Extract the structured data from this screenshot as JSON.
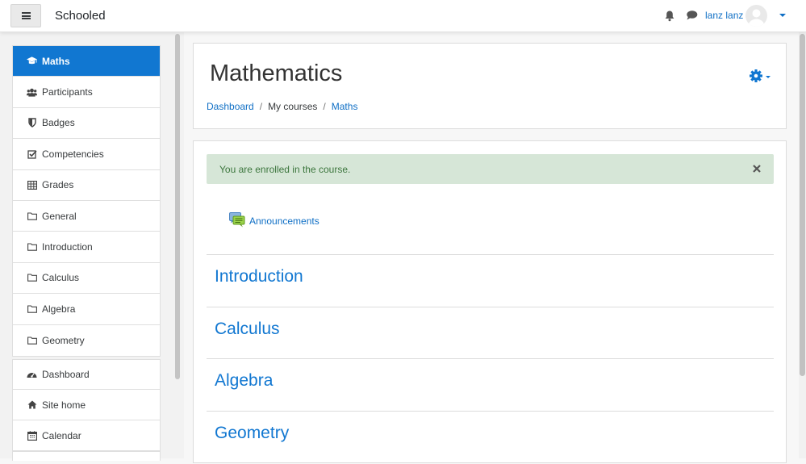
{
  "navbar": {
    "site_name": "Schooled",
    "user_name": "lanz lanz",
    "icons": [
      "menu-icon",
      "bell-icon",
      "chat-icon",
      "avatar-icon",
      "caret-down-icon"
    ]
  },
  "drawer": {
    "course_group": [
      {
        "label": "Maths",
        "icon": "graduation-cap-icon",
        "active": true
      },
      {
        "label": "Participants",
        "icon": "users-icon"
      },
      {
        "label": "Badges",
        "icon": "shield-icon"
      },
      {
        "label": "Competencies",
        "icon": "check-square-icon"
      },
      {
        "label": "Grades",
        "icon": "table-icon"
      },
      {
        "label": "General",
        "icon": "folder-icon"
      },
      {
        "label": "Introduction",
        "icon": "folder-icon"
      },
      {
        "label": "Calculus",
        "icon": "folder-icon"
      },
      {
        "label": "Algebra",
        "icon": "folder-icon"
      },
      {
        "label": "Geometry",
        "icon": "folder-icon"
      }
    ],
    "site_group": [
      {
        "label": "Dashboard",
        "icon": "dashboard-icon"
      },
      {
        "label": "Site home",
        "icon": "home-icon"
      },
      {
        "label": "Calendar",
        "icon": "calendar-icon"
      }
    ]
  },
  "header": {
    "title": "Mathematics",
    "breadcrumb": [
      {
        "label": "Dashboard",
        "link": true
      },
      {
        "label": "My courses",
        "link": false
      },
      {
        "label": "Maths",
        "link": true
      }
    ]
  },
  "main": {
    "alert": "You are enrolled in the course.",
    "activity": "Announcements",
    "sections": [
      "Introduction",
      "Calculus",
      "Algebra",
      "Geometry"
    ]
  },
  "colors": {
    "brand": "#1177d1",
    "link": "#0f6fc5",
    "alert_bg": "#d6e6d7",
    "alert_text": "#3c763d"
  }
}
